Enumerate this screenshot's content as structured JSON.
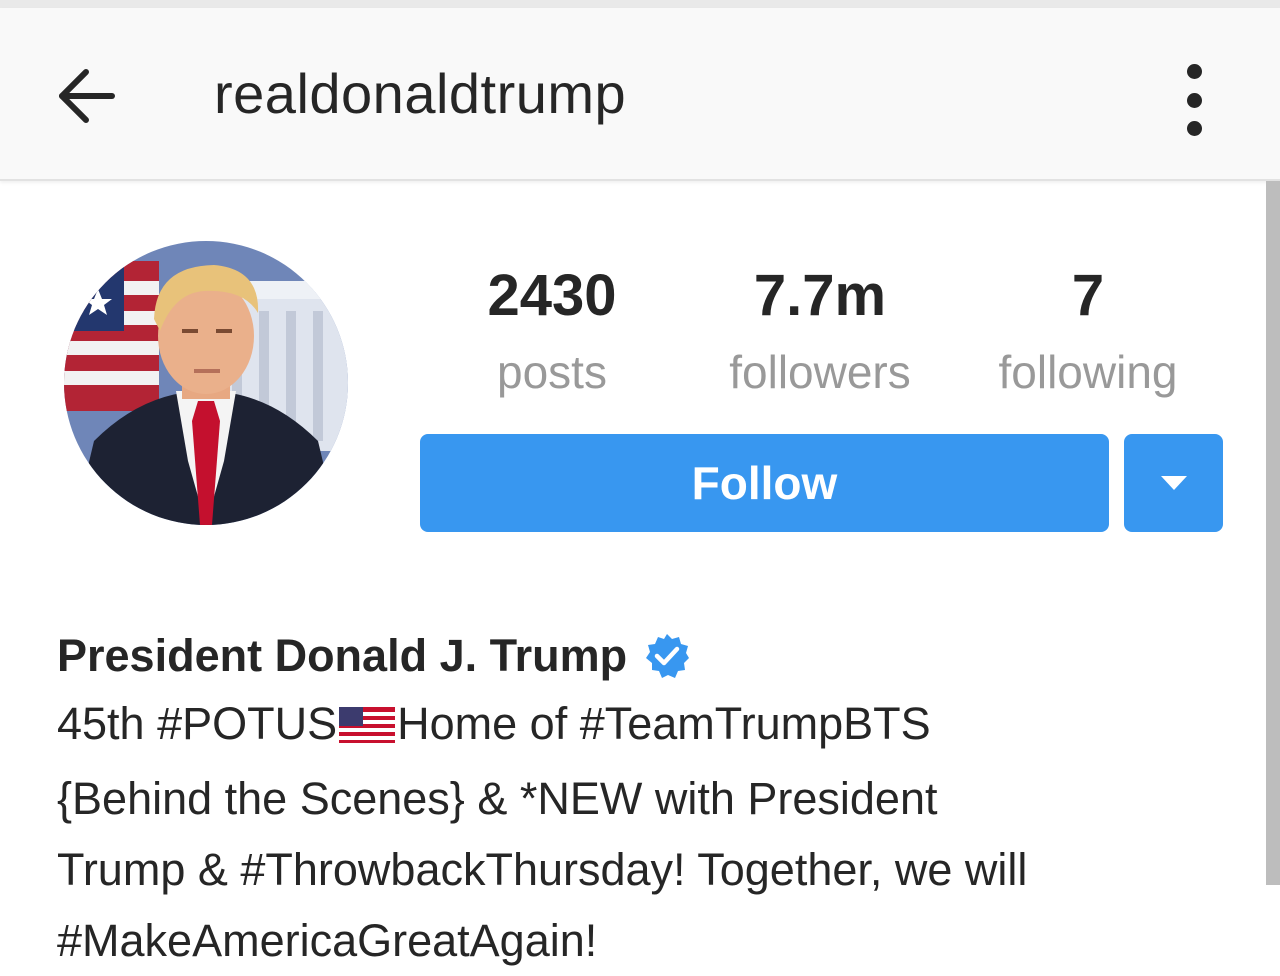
{
  "header": {
    "title": "realdonaldtrump",
    "back_icon": "arrow-left-icon",
    "more_icon": "more-vertical-icon"
  },
  "profile": {
    "avatar_alt": "profile photo",
    "stats": [
      {
        "value": "2430",
        "label": "posts"
      },
      {
        "value": "7.7m",
        "label": "followers"
      },
      {
        "value": "7",
        "label": "following"
      }
    ],
    "follow_label": "Follow",
    "dropdown_icon": "caret-down-icon",
    "name": "President Donald J. Trump",
    "verified_icon": "verified-badge-icon",
    "bio": {
      "line1_a": "45th #POTUS",
      "line1_b": "Home of #TeamTrumpBTS",
      "line2": "{Behind the Scenes} & *NEW with President",
      "line3": "Trump & #ThrowbackThursday! Together, we will",
      "line4": "#MakeAmericaGreatAgain!"
    }
  },
  "colors": {
    "accent": "#3897f0",
    "text": "#262626",
    "muted": "#999999",
    "header_bg": "#f9f9f9"
  }
}
